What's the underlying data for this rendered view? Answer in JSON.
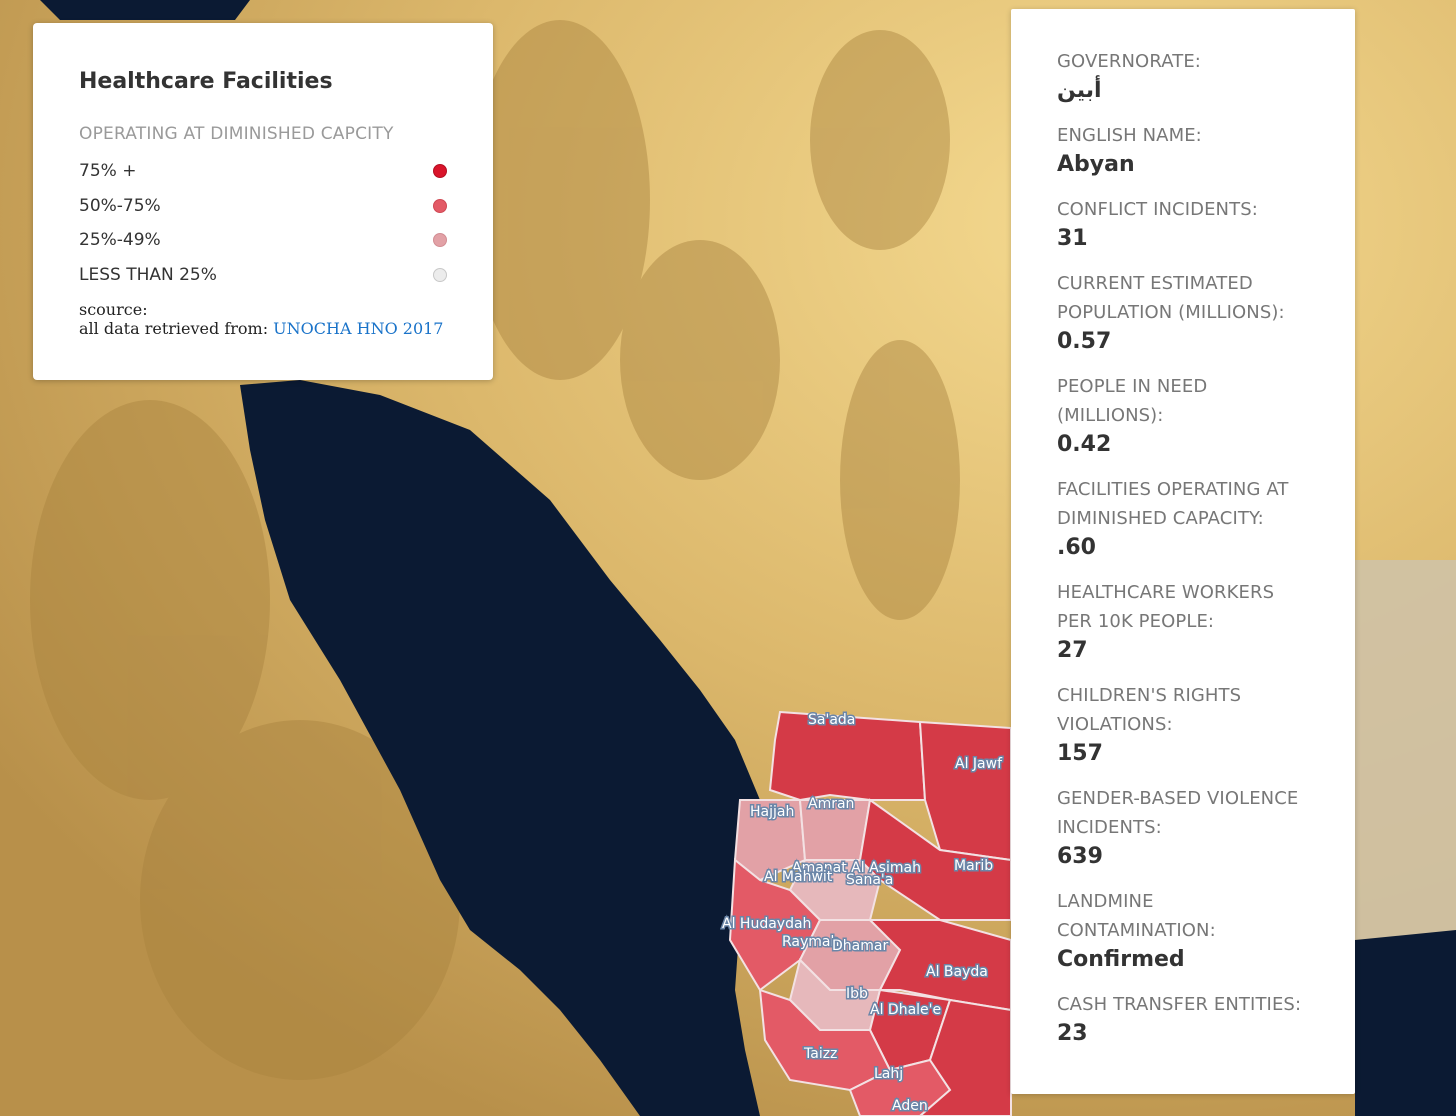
{
  "legend": {
    "title": "Healthcare Facilities",
    "subtitle": "OPERATING AT DIMINISHED CAPCITY",
    "items": [
      {
        "label": "75% +",
        "color": "#d9142a"
      },
      {
        "label": "50%-75%",
        "color": "#e35a66"
      },
      {
        "label": "25%-49%",
        "color": "#e2a1a6"
      },
      {
        "label": "LESS THAN 25%",
        "color": "#ececec"
      }
    ],
    "source_label": "scource:",
    "source_text": "all data retrieved from:",
    "source_link": "UNOCHA HNO 2017"
  },
  "info": {
    "fields": [
      {
        "label": "GOVERNORATE:",
        "value": "أبين"
      },
      {
        "label": "ENGLISH NAME:",
        "value": "Abyan"
      },
      {
        "label": "CONFLICT INCIDENTS:",
        "value": "31"
      },
      {
        "label": "CURRENT ESTIMATED POPULATION (MILLIONS):",
        "value": "0.57"
      },
      {
        "label": "PEOPLE IN NEED (MILLIONS):",
        "value": "0.42"
      },
      {
        "label": "FACILITIES OPERATING AT DIMINISHED CAPACITY:",
        "value": ".60"
      },
      {
        "label": "HEALTHCARE WORKERS PER 10K PEOPLE:",
        "value": "27"
      },
      {
        "label": "CHILDREN'S RIGHTS VIOLATIONS:",
        "value": "157"
      },
      {
        "label": "GENDER-BASED VIOLENCE INCIDENTS:",
        "value": "639"
      },
      {
        "label": "LANDMINE CONTAMINATION:",
        "value": "Confirmed"
      },
      {
        "label": "CASH TRANSFER ENTITIES:",
        "value": "23"
      }
    ]
  },
  "map": {
    "region_labels": [
      "Sa'ada",
      "Al Jawf",
      "Hajjah",
      "Amran",
      "Amanat Al Asimah",
      "Al Mahwit",
      "Sana'a",
      "Marib",
      "Al Hudaydah",
      "Raymah",
      "Dhamar",
      "Al Bayda",
      "Ibb",
      "Al Dhale'e",
      "Taizz",
      "Lahj",
      "Aden"
    ],
    "colors": {
      "sea": "#0b1a33",
      "land": "#d8b670",
      "high": "#d9142a",
      "mid": "#e35a66",
      "low": "#e2a1a6"
    }
  }
}
